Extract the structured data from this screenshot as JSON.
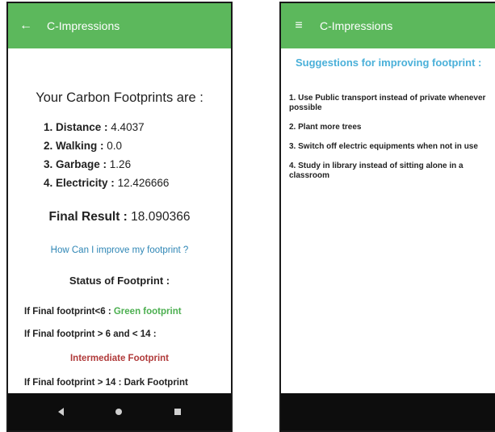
{
  "screen1": {
    "app_title": "C-Impressions",
    "back_icon": "←",
    "heading": "Your Carbon Footprints are :",
    "items": [
      {
        "label": "1. Distance :",
        "value": "4.4037"
      },
      {
        "label": "2. Walking :",
        "value": "0.0"
      },
      {
        "label": "3. Garbage :",
        "value": "1.26"
      },
      {
        "label": "4. Electricity :",
        "value": "12.426666"
      }
    ],
    "final_label": "Final Result :",
    "final_value": "18.090366",
    "improve_link": "How Can I improve my footprint ?",
    "status_heading": "Status of Footprint :",
    "rule1_prefix": "If Final footprint<6 :",
    "rule1_value": "Green footprint",
    "rule2": "If Final footprint > 6 and < 14 :",
    "rule2_value": "Intermediate Footprint",
    "rule3": "If Final footprint > 14 :  Dark Footprint"
  },
  "screen2": {
    "app_title": "C-Impressions",
    "menu_icon": "≡",
    "heading": "Suggestions for improving footprint :",
    "suggestions": [
      "1. Use Public transport instead of private whenever possible",
      "2. Plant more trees",
      "3. Switch off electric equipments when not in use",
      "4. Study in library instead of sitting alone in a classroom"
    ]
  },
  "colors": {
    "appbar": "#5cb85c",
    "link": "#2e86b5",
    "green_text": "#4caf50",
    "intermediate_text": "#b03a3a",
    "suggestion_heading": "#4ab0d9",
    "navbar": "#0d0d0d"
  },
  "icons": {
    "back": "back-arrow-icon",
    "menu": "hamburger-menu-icon",
    "nav_back": "nav-back-icon",
    "nav_home": "nav-home-icon",
    "nav_recents": "nav-recents-icon"
  }
}
